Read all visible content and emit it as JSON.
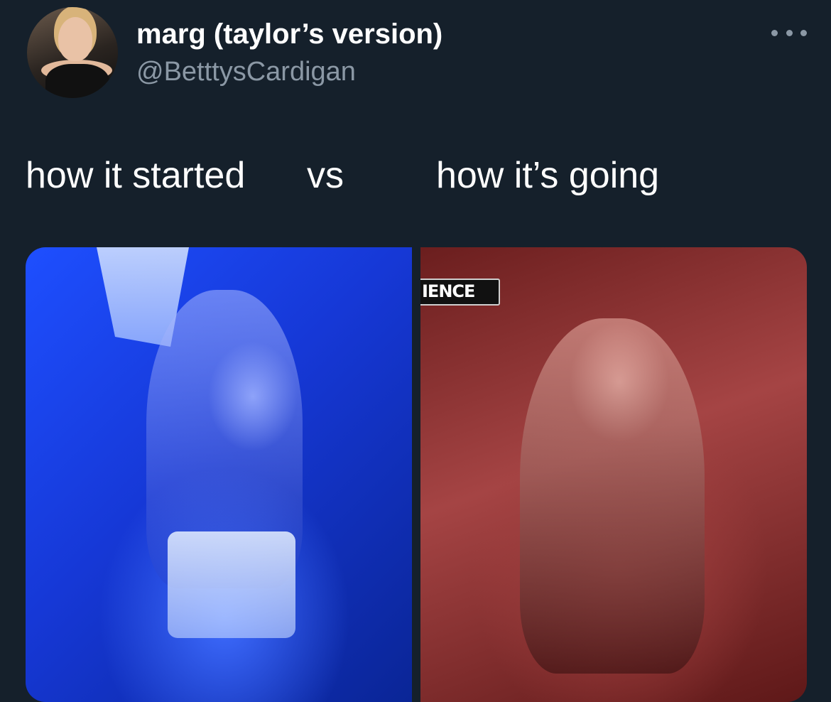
{
  "tweet": {
    "author": {
      "display_name": "marg (taylor’s version)",
      "handle": "@BetttysCardigan"
    },
    "text": "how it started      vs         how it’s going",
    "media": {
      "left_image": {},
      "right_image": {
        "overlay_text": "IENCE"
      }
    }
  },
  "colors": {
    "background": "#15202b",
    "text_primary": "#ffffff",
    "text_secondary": "#8b98a5"
  },
  "icons": {
    "more": "more-horizontal-icon"
  }
}
